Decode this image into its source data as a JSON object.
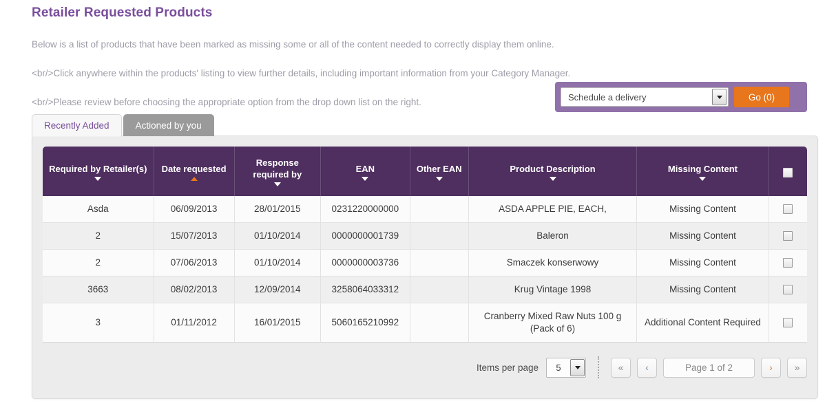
{
  "header": {
    "title": "Retailer Requested Products",
    "intro_lines": [
      "Below is a list of products that have been marked as missing some or all of the content needed to correctly display them online.",
      "<br/>Click anywhere within the products' listing to view further details, including important information from your Category Manager.",
      "<br/>Please review before choosing the appropriate option from the drop down list on the right."
    ]
  },
  "action_bar": {
    "dropdown_value": "Schedule a delivery",
    "dropdown_icon": "chevron-down-icon",
    "go_label": "Go (0)"
  },
  "tabs": [
    {
      "label": "Recently Added",
      "active": true
    },
    {
      "label": "Actioned by you",
      "active": false
    }
  ],
  "table": {
    "columns": [
      {
        "label": "Required by Retailer(s)",
        "sort": "down"
      },
      {
        "label": "Date requested",
        "sort": "up"
      },
      {
        "label": "Response required by",
        "sort": "down"
      },
      {
        "label": "EAN",
        "sort": "down"
      },
      {
        "label": "Other EAN",
        "sort": "down"
      },
      {
        "label": "Product Description",
        "sort": "down"
      },
      {
        "label": "Missing Content",
        "sort": "down"
      },
      {
        "label": "",
        "sort": "none"
      }
    ],
    "select_all_icon": "checkbox-icon",
    "rows": [
      {
        "required_by": "Asda",
        "date_requested": "06/09/2013",
        "response_required_by": "28/01/2015",
        "ean": "0231220000000",
        "other_ean": "",
        "description": "ASDA APPLE PIE, EACH,",
        "missing_content": "Missing Content",
        "checkbox": "checkbox-icon"
      },
      {
        "required_by": "2",
        "date_requested": "15/07/2013",
        "response_required_by": "01/10/2014",
        "ean": "0000000001739",
        "other_ean": "",
        "description": "Baleron",
        "missing_content": "Missing Content",
        "checkbox": "checkbox-icon"
      },
      {
        "required_by": "2",
        "date_requested": "07/06/2013",
        "response_required_by": "01/10/2014",
        "ean": "0000000003736",
        "other_ean": "",
        "description": "Smaczek konserwowy",
        "missing_content": "Missing Content",
        "checkbox": "checkbox-icon"
      },
      {
        "required_by": "3663",
        "date_requested": "08/02/2013",
        "response_required_by": "12/09/2014",
        "ean": "3258064033312",
        "other_ean": "",
        "description": "Krug Vintage 1998",
        "missing_content": "Missing Content",
        "checkbox": "checkbox-icon"
      },
      {
        "required_by": "3",
        "date_requested": "01/11/2012",
        "response_required_by": "16/01/2015",
        "ean": "5060165210992",
        "other_ean": "",
        "description": "Cranberry Mixed Raw Nuts 100 g (Pack of 6)",
        "missing_content": "Additional Content Required",
        "checkbox": "checkbox-icon"
      }
    ]
  },
  "pager": {
    "items_per_page_label": "Items per page",
    "items_per_page_value": "5",
    "first_label": "«",
    "prev_label": "‹",
    "page_info": "Page 1 of 2",
    "next_label": "›",
    "last_label": "»"
  },
  "colors": {
    "header_purple": "#4f2e60",
    "title_purple": "#7a4e9c",
    "frame_purple": "#9171a9",
    "accent_orange": "#e8761c",
    "panel_grey": "#ececec"
  }
}
